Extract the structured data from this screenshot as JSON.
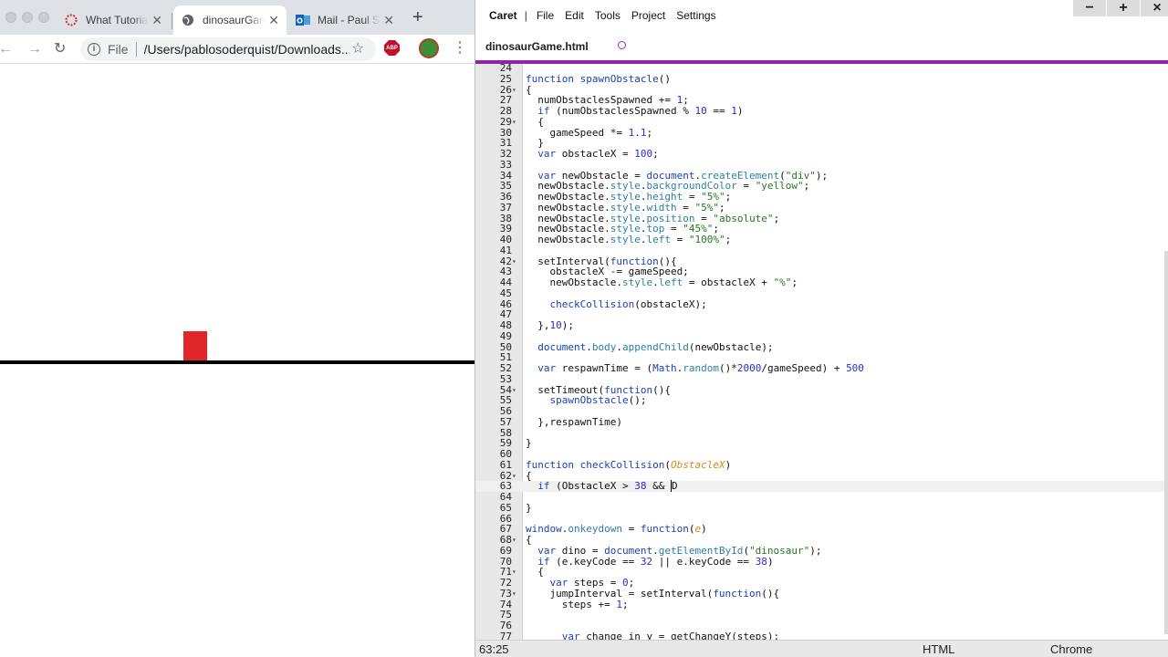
{
  "browser": {
    "tabs": [
      {
        "title": "What Tutorial",
        "icon": "loading-ring-icon"
      },
      {
        "title": "dinosaurGame",
        "icon": "globe-icon"
      },
      {
        "title": "Mail - Paul So",
        "icon": "outlook-mail-icon"
      }
    ],
    "omnibox": {
      "scheme_label": "File",
      "url": "/Users/pablosoderquist/Downloads..."
    },
    "extensions": {
      "abp_label": "ABP"
    },
    "page": {
      "obstacle_color": "#e0262b",
      "ground_color": "#000000"
    }
  },
  "editor": {
    "app_name": "Caret",
    "menu": [
      "File",
      "Edit",
      "Tools",
      "Project",
      "Settings"
    ],
    "window_buttons": [
      "−",
      "+",
      "×"
    ],
    "file_tab": "dinosaurGame.html",
    "accent_color": "#8e24aa",
    "lines": [
      {
        "n": 24,
        "text": ""
      },
      {
        "n": 25,
        "text": "function spawnObstacle()"
      },
      {
        "n": 26,
        "text": "{",
        "fold": true
      },
      {
        "n": 27,
        "text": "  numObstaclesSpawned += 1;"
      },
      {
        "n": 28,
        "text": "  if (numObstaclesSpawned % 10 == 1)"
      },
      {
        "n": 29,
        "text": "  {",
        "fold": true
      },
      {
        "n": 30,
        "text": "    gameSpeed *= 1.1;"
      },
      {
        "n": 31,
        "text": "  }"
      },
      {
        "n": 32,
        "text": "  var obstacleX = 100;"
      },
      {
        "n": 33,
        "text": ""
      },
      {
        "n": 34,
        "text": "  var newObstacle = document.createElement(\"div\");"
      },
      {
        "n": 35,
        "text": "  newObstacle.style.backgroundColor = \"yellow\";"
      },
      {
        "n": 36,
        "text": "  newObstacle.style.height = \"5%\";"
      },
      {
        "n": 37,
        "text": "  newObstacle.style.width = \"5%\";"
      },
      {
        "n": 38,
        "text": "  newObstacle.style.position = \"absolute\";"
      },
      {
        "n": 39,
        "text": "  newObstacle.style.top = \"45%\";"
      },
      {
        "n": 40,
        "text": "  newObstacle.style.left = \"100%\";"
      },
      {
        "n": 41,
        "text": ""
      },
      {
        "n": 42,
        "text": "  setInterval(function(){",
        "fold": true
      },
      {
        "n": 43,
        "text": "    obstacleX -= gameSpeed;"
      },
      {
        "n": 44,
        "text": "    newObstacle.style.left = obstacleX + \"%\";"
      },
      {
        "n": 45,
        "text": ""
      },
      {
        "n": 46,
        "text": "    checkCollision(obstacleX);"
      },
      {
        "n": 47,
        "text": ""
      },
      {
        "n": 48,
        "text": "  },10);"
      },
      {
        "n": 49,
        "text": ""
      },
      {
        "n": 50,
        "text": "  document.body.appendChild(newObstacle);"
      },
      {
        "n": 51,
        "text": ""
      },
      {
        "n": 52,
        "text": "  var respawnTime = (Math.random()*2000/gameSpeed) + 500"
      },
      {
        "n": 53,
        "text": ""
      },
      {
        "n": 54,
        "text": "  setTimeout(function(){",
        "fold": true
      },
      {
        "n": 55,
        "text": "    spawnObstacle();"
      },
      {
        "n": 56,
        "text": ""
      },
      {
        "n": 57,
        "text": "  },respawnTime)"
      },
      {
        "n": 58,
        "text": ""
      },
      {
        "n": 59,
        "text": "}"
      },
      {
        "n": 60,
        "text": ""
      },
      {
        "n": 61,
        "text": "function checkCollision(ObstacleX)"
      },
      {
        "n": 62,
        "text": "{",
        "fold": true
      },
      {
        "n": 63,
        "text": "  if (ObstacleX > 38 && D",
        "current": true
      },
      {
        "n": 64,
        "text": ""
      },
      {
        "n": 65,
        "text": "}"
      },
      {
        "n": 66,
        "text": ""
      },
      {
        "n": 67,
        "text": "window.onkeydown = function(e)"
      },
      {
        "n": 68,
        "text": "{",
        "fold": true
      },
      {
        "n": 69,
        "text": "  var dino = document.getElementById(\"dinosaur\");"
      },
      {
        "n": 70,
        "text": "  if (e.keyCode == 32 || e.keyCode == 38)"
      },
      {
        "n": 71,
        "text": "  {",
        "fold": true
      },
      {
        "n": 72,
        "text": "    var steps = 0;"
      },
      {
        "n": 73,
        "text": "    jumpInterval = setInterval(function(){",
        "fold": true
      },
      {
        "n": 74,
        "text": "      steps += 1;"
      },
      {
        "n": 75,
        "text": ""
      },
      {
        "n": 76,
        "text": ""
      },
      {
        "n": 77,
        "text": "      var change_in_y = getChangeY(steps);"
      }
    ],
    "status": {
      "position": "63:25",
      "mode": "HTML",
      "target": "Chrome"
    }
  }
}
